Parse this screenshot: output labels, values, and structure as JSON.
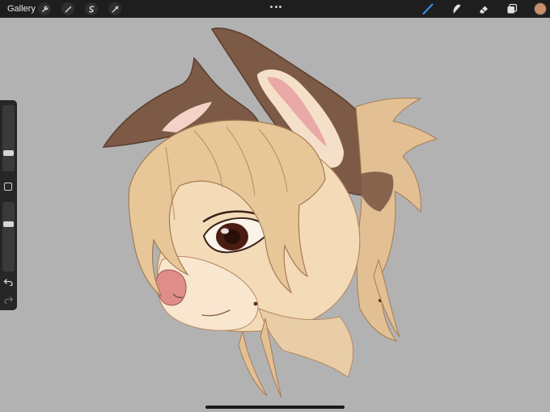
{
  "topbar": {
    "gallery_label": "Gallery",
    "left_tools": [
      "wrench-icon",
      "magic-wand-icon",
      "selection-icon",
      "transform-icon"
    ],
    "right_tools": [
      "brush-icon",
      "smudge-icon",
      "eraser-icon",
      "layers-icon"
    ],
    "active_tool": "brush-icon",
    "current_color": "#c98f6b",
    "active_color": "#3b8ef0"
  },
  "sidebar": {
    "brush_size_level": 0.75,
    "opacity_level": 0.3,
    "undo_icon": "undo-icon",
    "redo_icon": "redo-icon"
  },
  "canvas": {
    "background": "#b2b2b2",
    "artwork": "anthro-rabbit-portrait"
  }
}
